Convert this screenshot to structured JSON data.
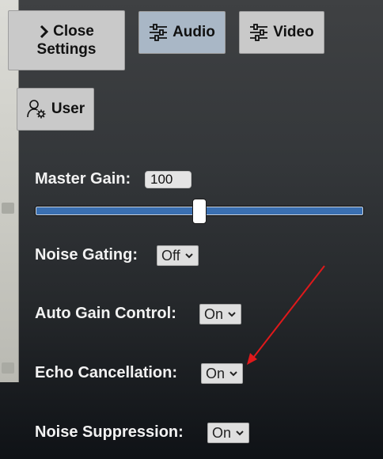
{
  "buttons": {
    "close_line1": "Close",
    "close_line2": "Settings",
    "audio": "Audio",
    "video": "Video",
    "user": "User"
  },
  "master_gain": {
    "label": "Master Gain:",
    "value": "100",
    "slider_value": 100
  },
  "settings": {
    "noise_gating": {
      "label": "Noise Gating:",
      "value": "Off"
    },
    "auto_gain": {
      "label": "Auto Gain Control:",
      "value": "On"
    },
    "echo_cancellation": {
      "label": "Echo Cancellation:",
      "value": "On"
    },
    "noise_suppression": {
      "label": "Noise Suppression:",
      "value": "On"
    }
  },
  "colors": {
    "active_tab": "#a9b7c6",
    "slider_fill": "#3a6fb1",
    "annotation_arrow": "#e0191b"
  }
}
